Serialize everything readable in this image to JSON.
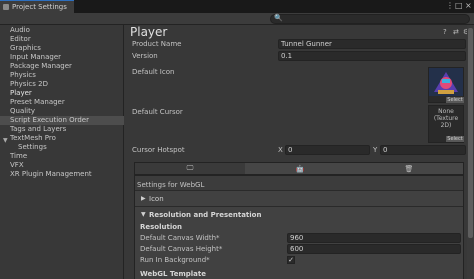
{
  "window": {
    "tab_title": "Project Settings",
    "controls": [
      "⋮",
      "□",
      "×"
    ]
  },
  "search": {
    "placeholder": ""
  },
  "sidebar": {
    "items": [
      "Audio",
      "Editor",
      "Graphics",
      "Input Manager",
      "Package Manager",
      "Physics",
      "Physics 2D",
      "Player",
      "Preset Manager",
      "Quality",
      "Script Execution Order",
      "Tags and Layers",
      "TextMesh Pro",
      "Settings",
      "Time",
      "VFX",
      "XR Plugin Management"
    ],
    "selected": "Player"
  },
  "main": {
    "title": "Player",
    "product_name_label": "Product Name",
    "product_name_value": "Tunnel Gunner",
    "version_label": "Version",
    "version_value": "0.1",
    "default_icon_label": "Default Icon",
    "icon_select": "Select",
    "default_cursor_label": "Default Cursor",
    "cursor_none": "None",
    "cursor_type": "(Texture 2D)",
    "cursor_select": "Select",
    "hotspot_label": "Cursor Hotspot",
    "hotspot_x_label": "X",
    "hotspot_x": "0",
    "hotspot_y_label": "Y",
    "hotspot_y": "0"
  },
  "platform_tabs": [
    {
      "icon": "monitor-icon",
      "glyph": "🖵"
    },
    {
      "icon": "android-icon",
      "glyph": "🤖"
    },
    {
      "icon": "webgl-icon",
      "glyph": "🗑"
    }
  ],
  "webgl": {
    "settings_title": "Settings for WebGL",
    "icon_section": "Icon",
    "res_section": "Resolution and Presentation",
    "resolution_header": "Resolution",
    "canvas_width_label": "Default Canvas Width*",
    "canvas_width": "960",
    "canvas_height_label": "Default Canvas Height*",
    "canvas_height": "600",
    "run_bg_label": "Run In Background*",
    "run_bg_checked": true,
    "template_header": "WebGL Template"
  },
  "colors": {
    "accent": "#2d6fbf",
    "background": "#383838",
    "selected": "#4d4d4d"
  }
}
